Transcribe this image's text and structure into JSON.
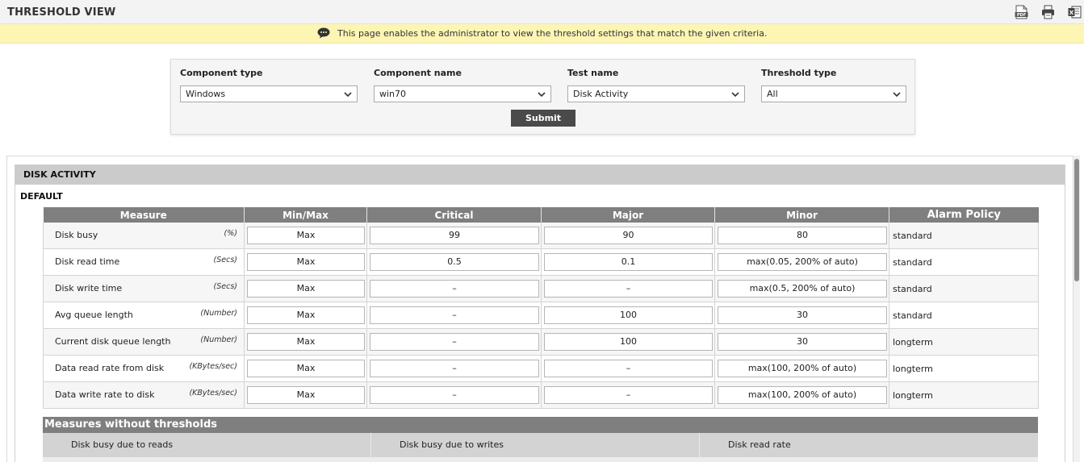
{
  "header": {
    "title": "THRESHOLD VIEW",
    "icons": [
      "pdf-icon",
      "print-icon",
      "excel-icon"
    ]
  },
  "info": {
    "text": "This page enables the administrator to view the threshold settings that match the given criteria."
  },
  "filters": {
    "component_type": {
      "label": "Component type",
      "value": "Windows"
    },
    "component_name": {
      "label": "Component name",
      "value": "win70"
    },
    "test_name": {
      "label": "Test name",
      "value": "Disk Activity"
    },
    "threshold_type": {
      "label": "Threshold type",
      "value": "All"
    },
    "submit_label": "Submit"
  },
  "section": {
    "title": "DISK ACTIVITY",
    "group_label": "DEFAULT"
  },
  "table": {
    "headers": {
      "measure": "Measure",
      "minmax": "Min/Max",
      "critical": "Critical",
      "major": "Major",
      "minor": "Minor",
      "policy": "Alarm Policy"
    },
    "rows": [
      {
        "measure": "Disk busy",
        "unit": "(%)",
        "minmax": "Max",
        "critical": "99",
        "major": "90",
        "minor": "80",
        "policy": "standard"
      },
      {
        "measure": "Disk read time",
        "unit": "(Secs)",
        "minmax": "Max",
        "critical": "0.5",
        "major": "0.1",
        "minor": "max(0.05, 200% of auto)",
        "policy": "standard"
      },
      {
        "measure": "Disk write time",
        "unit": "(Secs)",
        "minmax": "Max",
        "critical": "–",
        "major": "–",
        "minor": "max(0.5, 200% of auto)",
        "policy": "standard"
      },
      {
        "measure": "Avg queue length",
        "unit": "(Number)",
        "minmax": "Max",
        "critical": "–",
        "major": "100",
        "minor": "30",
        "policy": "standard"
      },
      {
        "measure": "Current disk queue length",
        "unit": "(Number)",
        "minmax": "Max",
        "critical": "–",
        "major": "100",
        "minor": "30",
        "policy": "longterm"
      },
      {
        "measure": "Data read rate from disk",
        "unit": "(KBytes/sec)",
        "minmax": "Max",
        "critical": "–",
        "major": "–",
        "minor": "max(100, 200% of auto)",
        "policy": "longterm"
      },
      {
        "measure": "Data write rate to disk",
        "unit": "(KBytes/sec)",
        "minmax": "Max",
        "critical": "–",
        "major": "–",
        "minor": "max(100, 200% of auto)",
        "policy": "longterm"
      }
    ]
  },
  "measures_without_thresholds": {
    "title": "Measures without thresholds",
    "items": [
      "Disk busy due to reads",
      "Disk busy due to writes",
      "Disk read rate"
    ]
  },
  "colors": {
    "info_bar": "#fcf5b4",
    "table_header": "#7f7f7f",
    "section_header": "#cbcbcb",
    "submit_button": "#4a4a4a"
  }
}
